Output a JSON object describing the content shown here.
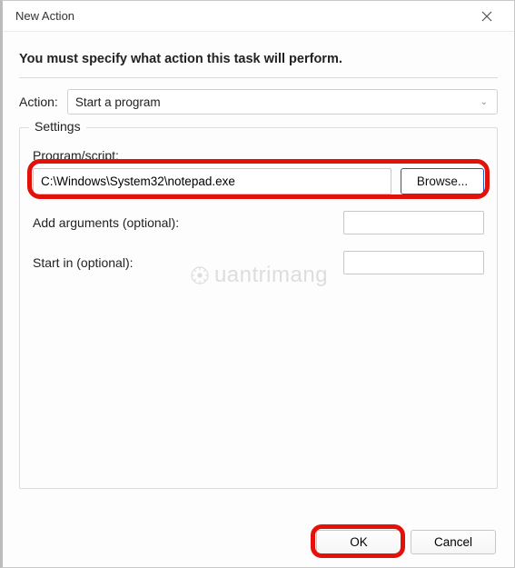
{
  "window": {
    "title": "New Action"
  },
  "instruction": "You must specify what action this task will perform.",
  "actionRow": {
    "label": "Action:",
    "selected": "Start a program"
  },
  "settings": {
    "legend": "Settings",
    "programLabel": "Program/script:",
    "programValue": "C:\\Windows\\System32\\notepad.exe",
    "browseLabel": "Browse...",
    "argsLabel": "Add arguments (optional):",
    "argsValue": "",
    "startInLabel": "Start in (optional):",
    "startInValue": ""
  },
  "watermark": "uantrimang",
  "footer": {
    "ok": "OK",
    "cancel": "Cancel"
  }
}
